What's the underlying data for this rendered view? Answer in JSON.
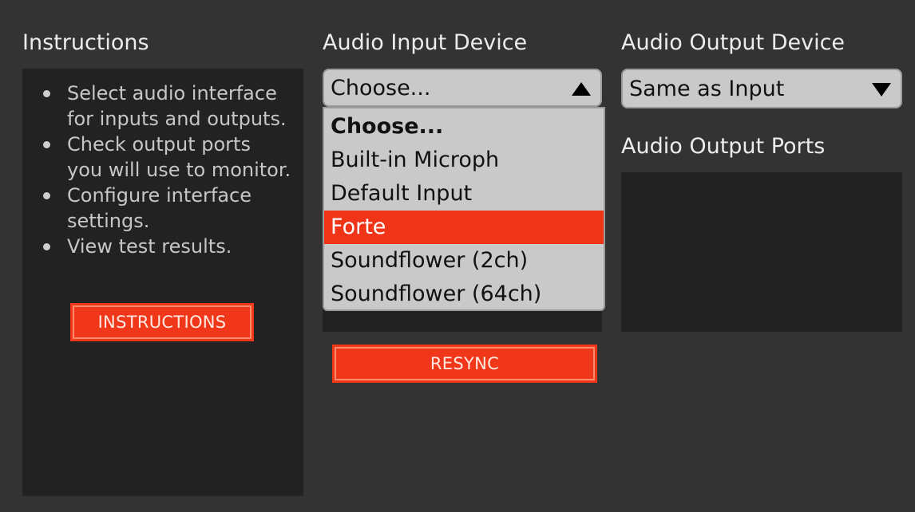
{
  "instructions": {
    "heading": "Instructions",
    "items": [
      {
        "line1": "Select audio interface",
        "line2": "for inputs and outputs."
      },
      {
        "line1": "Check output ports",
        "line2": "you will use to monitor."
      },
      {
        "line1": "Configure interface",
        "line2": "settings."
      },
      {
        "line1": "View test results.",
        "line2": ""
      }
    ],
    "button_label": "INSTRUCTIONS"
  },
  "input_device": {
    "heading": "Audio Input Device",
    "selected": "Choose...",
    "expanded": true,
    "options": [
      "Choose...",
      "Built-in Microph",
      "Default Input",
      "Forte",
      "Soundflower (2ch)",
      "Soundflower (64ch)"
    ],
    "highlighted_option": "Forte",
    "resync_label": "RESYNC"
  },
  "output_device": {
    "heading": "Audio Output Device",
    "selected": "Same as Input",
    "ports_heading": "Audio Output Ports"
  },
  "colors": {
    "background": "#333333",
    "panel": "#222222",
    "accent": "#f0371a",
    "select_bg": "#c9c9c9"
  },
  "icons": {
    "input_select_arrow": "triangle-up-icon",
    "output_select_arrow": "triangle-down-icon"
  }
}
